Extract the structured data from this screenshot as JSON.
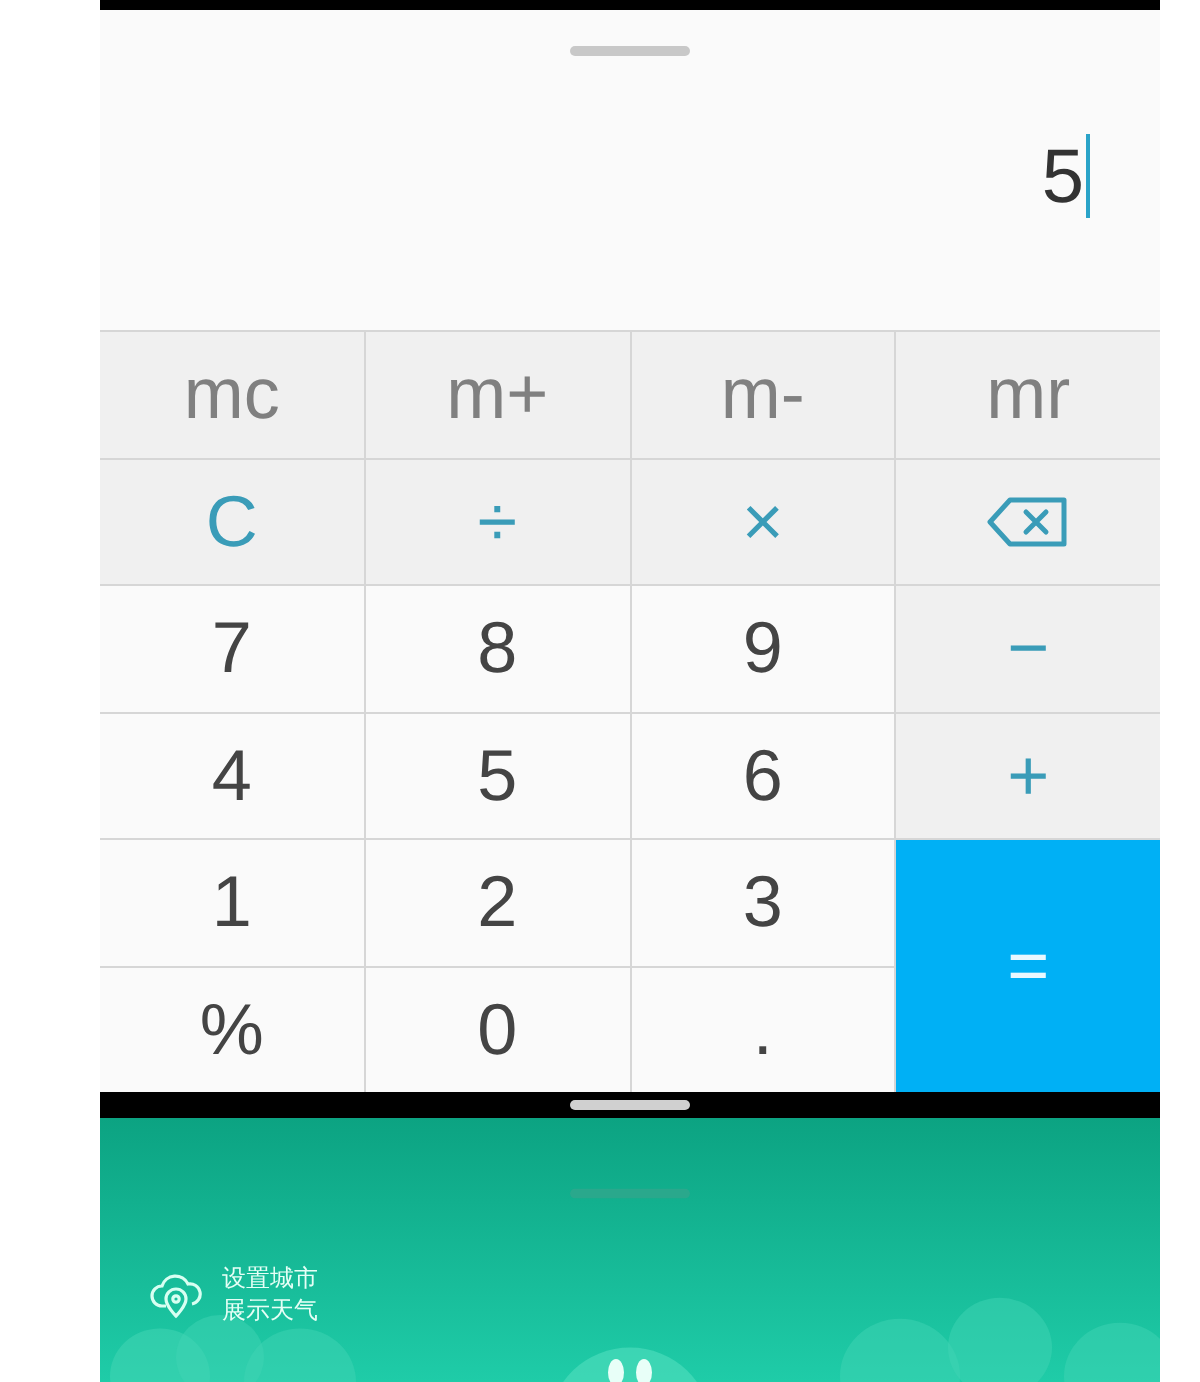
{
  "display": {
    "value": "5",
    "cursor": true
  },
  "keys": [
    {
      "kind": "memory",
      "label": "mc"
    },
    {
      "kind": "memory",
      "label": "m+"
    },
    {
      "kind": "memory",
      "label": "m-"
    },
    {
      "kind": "memory",
      "label": "mr"
    },
    {
      "kind": "operator",
      "label": "C"
    },
    {
      "kind": "operator",
      "label": "÷"
    },
    {
      "kind": "operator",
      "label": "×"
    },
    {
      "kind": "backspace"
    },
    {
      "kind": "digit",
      "label": "7"
    },
    {
      "kind": "digit",
      "label": "8"
    },
    {
      "kind": "digit",
      "label": "9"
    },
    {
      "kind": "side",
      "label": "−"
    },
    {
      "kind": "digit",
      "label": "4"
    },
    {
      "kind": "digit",
      "label": "5"
    },
    {
      "kind": "digit",
      "label": "6"
    },
    {
      "kind": "side",
      "label": "+"
    },
    {
      "kind": "digit",
      "label": "1"
    },
    {
      "kind": "digit",
      "label": "2"
    },
    {
      "kind": "digit",
      "label": "3"
    },
    {
      "kind": "equals",
      "label": "="
    },
    {
      "kind": "digit",
      "label": "%"
    },
    {
      "kind": "digit",
      "label": "0"
    },
    {
      "kind": "digit",
      "label": "."
    }
  ],
  "weather_widget": {
    "lines": [
      "设置城市",
      "展示天气"
    ]
  }
}
